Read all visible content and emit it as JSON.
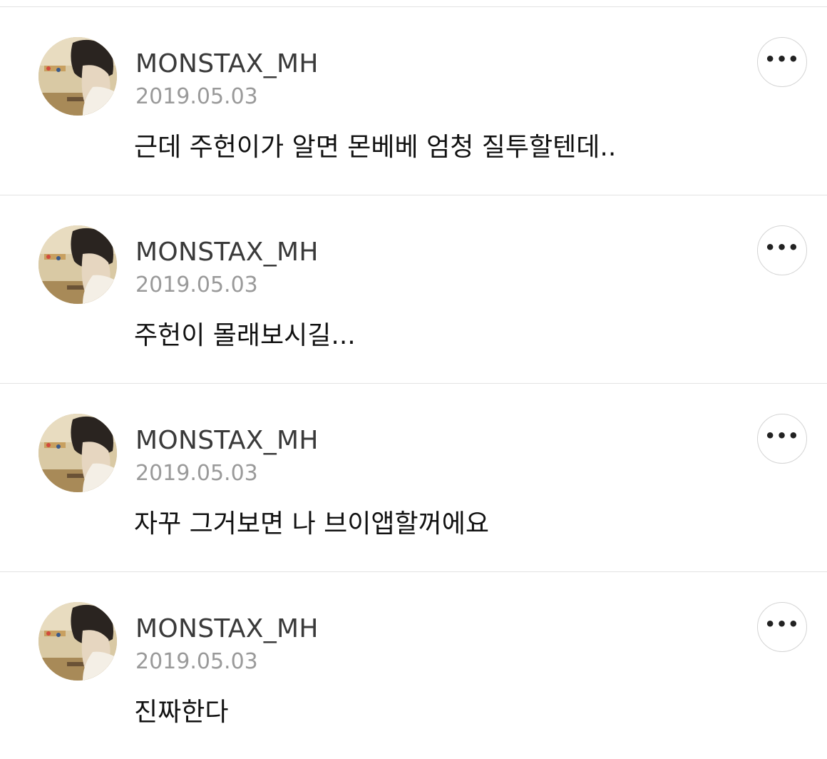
{
  "comments": [
    {
      "username": "MONSTAX_MH",
      "date": "2019.05.03",
      "text": "근데 주헌이가 알면 몬베베 엄청 질투할텐데..",
      "more_label": "•••"
    },
    {
      "username": "MONSTAX_MH",
      "date": "2019.05.03",
      "text": "주헌이 몰래보시길...",
      "more_label": "•••"
    },
    {
      "username": "MONSTAX_MH",
      "date": "2019.05.03",
      "text": "자꾸 그거보면 나 브이앱할꺼에요",
      "more_label": "•••"
    },
    {
      "username": "MONSTAX_MH",
      "date": "2019.05.03",
      "text": "진짜한다",
      "more_label": "•••"
    }
  ],
  "colors": {
    "username": "#3a3a3a",
    "date": "#9a9a9a",
    "text": "#111111",
    "divider": "#e3e3e3"
  },
  "icons": {
    "more": "more-horizontal-icon",
    "avatar": "profile-photo"
  }
}
